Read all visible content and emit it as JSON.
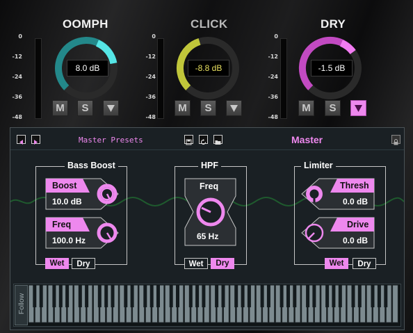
{
  "channels": [
    {
      "name": "OOMPH",
      "value": "8.0 dB",
      "title_color": "#f2f2f2",
      "ring_color": "#3cc8c8",
      "value_color": "#ffffff",
      "buttons": {
        "mute": "M",
        "solo": "S"
      },
      "scale": [
        "0",
        "-12",
        "-24",
        "-36",
        "-48"
      ]
    },
    {
      "name": "CLICK",
      "value": "-8.8 dB",
      "title_color": "#b9b9b9",
      "ring_color": "#d6dc3c",
      "value_color": "#e8e060",
      "buttons": {
        "mute": "M",
        "solo": "S"
      },
      "scale": [
        "0",
        "-12",
        "-24",
        "-36",
        "-48"
      ]
    },
    {
      "name": "DRY",
      "value": "-1.5 dB",
      "title_color": "#f2f2f2",
      "ring_color": "#e05ee0",
      "value_color": "#ffffff",
      "buttons": {
        "mute": "M",
        "solo": "S"
      },
      "scale": [
        "0",
        "-12",
        "-24",
        "-36",
        "-48"
      ]
    }
  ],
  "panel": {
    "presets_label": "Master Presets",
    "title": "Master",
    "accent": "#ee88ee"
  },
  "bass_boost": {
    "title": "Bass Boost",
    "params": [
      {
        "label": "Boost",
        "value": "10.0 dB"
      },
      {
        "label": "Freq",
        "value": "100.0 Hz"
      }
    ],
    "wet": "Wet",
    "dry": "Dry"
  },
  "hpf": {
    "title": "HPF",
    "label": "Freq",
    "value": "65 Hz",
    "wet": "Wet",
    "dry": "Dry"
  },
  "limiter": {
    "title": "Limiter",
    "params": [
      {
        "label": "Thresh",
        "value": "0.0 dB"
      },
      {
        "label": "Drive",
        "value": "0.0 dB"
      }
    ],
    "wet": "Wet",
    "dry": "Dry"
  },
  "keyboard": {
    "follow_label": "Follow"
  },
  "icons": [
    "prev-icon",
    "next-icon",
    "save-icon",
    "reload-icon",
    "folder-icon",
    "lock-icon",
    "arrow-down-icon"
  ]
}
